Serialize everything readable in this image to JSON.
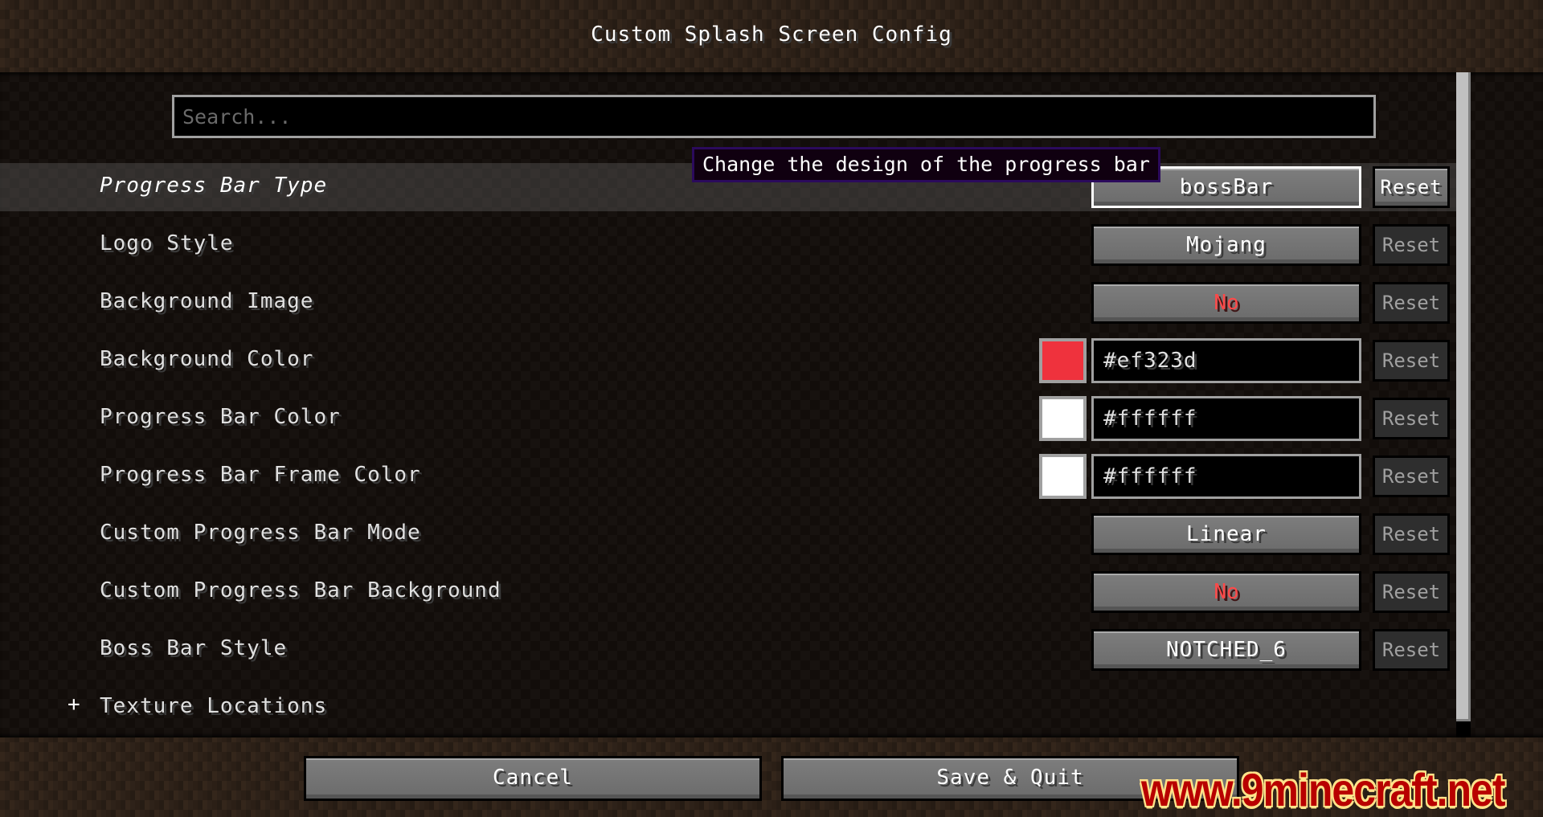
{
  "window": {
    "title": "Custom Splash Screen Config"
  },
  "search": {
    "placeholder": "Search...",
    "value": ""
  },
  "tooltip": {
    "text": "Change the design of the progress bar"
  },
  "rows": [
    {
      "label": "Progress Bar Type",
      "type": "cycle",
      "value": "bossBar",
      "reset": "Reset",
      "reset_enabled": true,
      "hovered": true
    },
    {
      "label": "Logo Style",
      "type": "cycle",
      "value": "Mojang",
      "reset": "Reset",
      "reset_enabled": false
    },
    {
      "label": "Background Image",
      "type": "toggle",
      "value": "No",
      "reset": "Reset",
      "reset_enabled": false
    },
    {
      "label": "Background Color",
      "type": "color",
      "value": "#ef323d",
      "swatch": "#ef323d",
      "reset": "Reset",
      "reset_enabled": false
    },
    {
      "label": "Progress Bar Color",
      "type": "color",
      "value": "#ffffff",
      "swatch": "#ffffff",
      "reset": "Reset",
      "reset_enabled": false
    },
    {
      "label": "Progress Bar Frame Color",
      "type": "color",
      "value": "#ffffff",
      "swatch": "#ffffff",
      "reset": "Reset",
      "reset_enabled": false
    },
    {
      "label": "Custom Progress Bar Mode",
      "type": "cycle",
      "value": "Linear",
      "reset": "Reset",
      "reset_enabled": false
    },
    {
      "label": "Custom Progress Bar Background",
      "type": "toggle",
      "value": "No",
      "reset": "Reset",
      "reset_enabled": false
    },
    {
      "label": "Boss Bar Style",
      "type": "cycle",
      "value": "NOTCHED_6",
      "reset": "Reset",
      "reset_enabled": false
    },
    {
      "label": "Texture Locations",
      "type": "category",
      "expand_symbol": "+"
    }
  ],
  "footer": {
    "cancel_label": "Cancel",
    "save_label": "Save & Quit"
  },
  "watermark": {
    "text": "www.9minecraft.net"
  },
  "colors": {
    "no_value": "#ff4848",
    "tooltip_border": "#2b0a5c"
  }
}
